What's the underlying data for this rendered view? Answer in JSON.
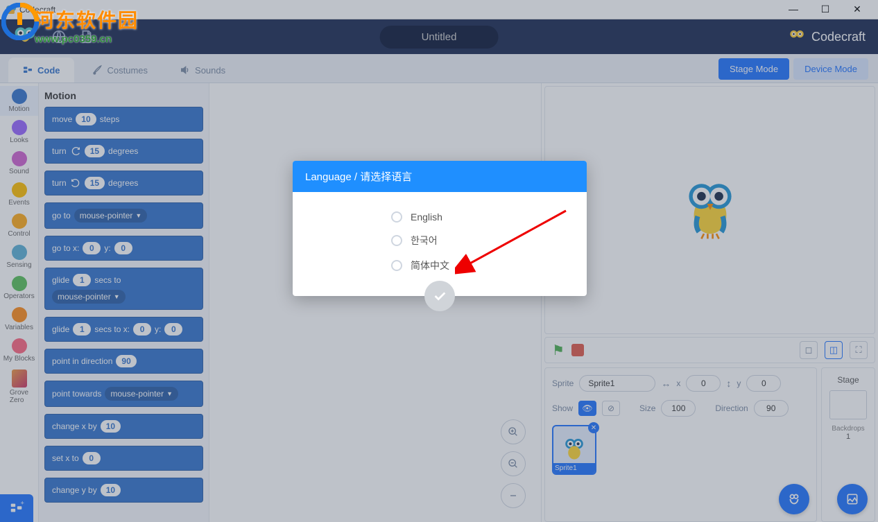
{
  "window": {
    "title": "Codecraft"
  },
  "watermark": {
    "line1": "河东软件园",
    "line2": "www.pc0359.cn"
  },
  "topbar": {
    "project_title": "Untitled",
    "brand": "Codecraft"
  },
  "tabs": {
    "code": "Code",
    "costumes": "Costumes",
    "sounds": "Sounds"
  },
  "modes": {
    "stage": "Stage Mode",
    "device": "Device Mode"
  },
  "categories": [
    {
      "name": "Motion",
      "color": "#3373cc"
    },
    {
      "name": "Looks",
      "color": "#9966ff"
    },
    {
      "name": "Sound",
      "color": "#cf63cf"
    },
    {
      "name": "Events",
      "color": "#ffbf00"
    },
    {
      "name": "Control",
      "color": "#ffab19"
    },
    {
      "name": "Sensing",
      "color": "#5cb1d6"
    },
    {
      "name": "Operators",
      "color": "#59c059"
    },
    {
      "name": "Variables",
      "color": "#ff8c1a"
    },
    {
      "name": "My Blocks",
      "color": "#ff6680"
    },
    {
      "name": "Grove Zero",
      "color": ""
    }
  ],
  "blocks": {
    "heading": "Motion",
    "move": {
      "pre": "move",
      "val": "10",
      "post": "steps"
    },
    "turn_cw": {
      "pre": "turn",
      "val": "15",
      "post": "degrees"
    },
    "turn_ccw": {
      "pre": "turn",
      "val": "15",
      "post": "degrees"
    },
    "goto": {
      "pre": "go to",
      "target": "mouse-pointer"
    },
    "gotoxy": {
      "pre": "go to x:",
      "x": "0",
      "mid": "y:",
      "y": "0"
    },
    "glide": {
      "pre": "glide",
      "secs": "1",
      "mid": "secs to",
      "target": "mouse-pointer"
    },
    "glidexy": {
      "pre": "glide",
      "secs": "1",
      "mid": "secs to x:",
      "x": "0",
      "mid2": "y:",
      "y": "0"
    },
    "pointdir": {
      "pre": "point in direction",
      "val": "90"
    },
    "pointto": {
      "pre": "point towards",
      "target": "mouse-pointer"
    },
    "changex": {
      "pre": "change x by",
      "val": "10"
    },
    "setx": {
      "pre": "set x to",
      "val": "0"
    },
    "changey": {
      "pre": "change y by",
      "val": "10"
    }
  },
  "sprite_info": {
    "label_sprite": "Sprite",
    "name": "Sprite1",
    "x_label": "x",
    "x": "0",
    "y_label": "y",
    "y": "0",
    "show_label": "Show",
    "size_label": "Size",
    "size": "100",
    "dir_label": "Direction",
    "dir": "90",
    "thumb_name": "Sprite1"
  },
  "stage_info": {
    "label": "Stage",
    "backdrops_label": "Backdrops",
    "backdrops_count": "1"
  },
  "modal": {
    "title": "Language / 请选择语言",
    "opts": [
      "English",
      "한국어",
      "简体中文"
    ]
  }
}
